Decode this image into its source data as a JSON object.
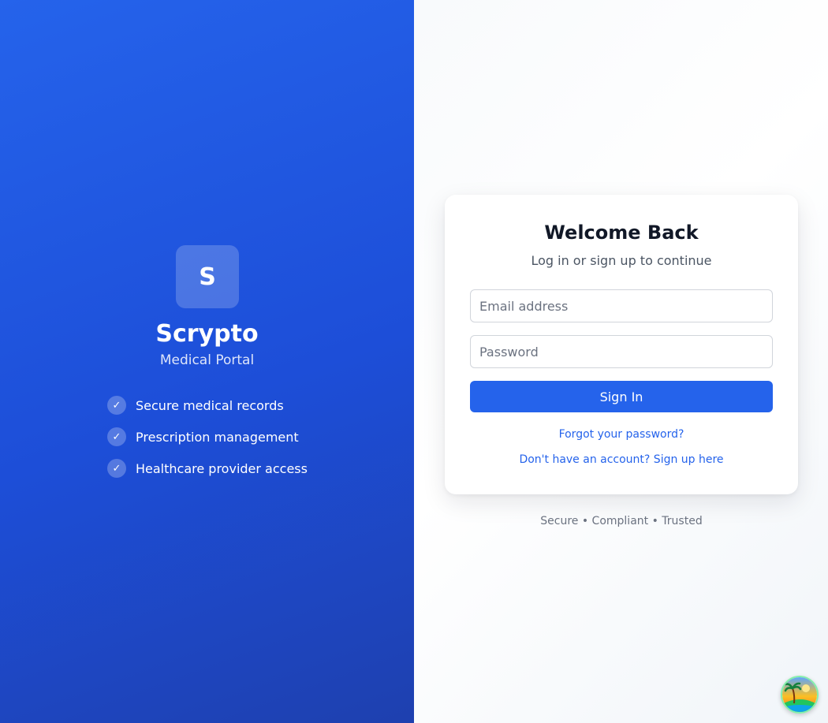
{
  "brand": {
    "logo_letter": "S",
    "name": "Scrypto",
    "subtitle": "Medical Portal",
    "features": [
      {
        "check": "✓",
        "label": "Secure medical records"
      },
      {
        "check": "✓",
        "label": "Prescription management"
      },
      {
        "check": "✓",
        "label": "Healthcare provider access"
      }
    ]
  },
  "login": {
    "title": "Welcome Back",
    "subtitle": "Log in or sign up to continue",
    "email_placeholder": "Email address",
    "email_value": "",
    "password_placeholder": "Password",
    "password_value": "",
    "submit_label": "Sign In",
    "forgot_label": "Forgot your password?",
    "signup_label": "Don't have an account? Sign up here"
  },
  "footer": {
    "note": "Secure • Compliant • Trusted"
  },
  "avatar": {
    "icon": "island-avatar-icon"
  },
  "colors": {
    "primary": "#2563eb",
    "brand_panel_start": "#2563eb",
    "brand_panel_end": "#1e40af",
    "title_text": "#111827",
    "muted_text": "#6b7280"
  }
}
